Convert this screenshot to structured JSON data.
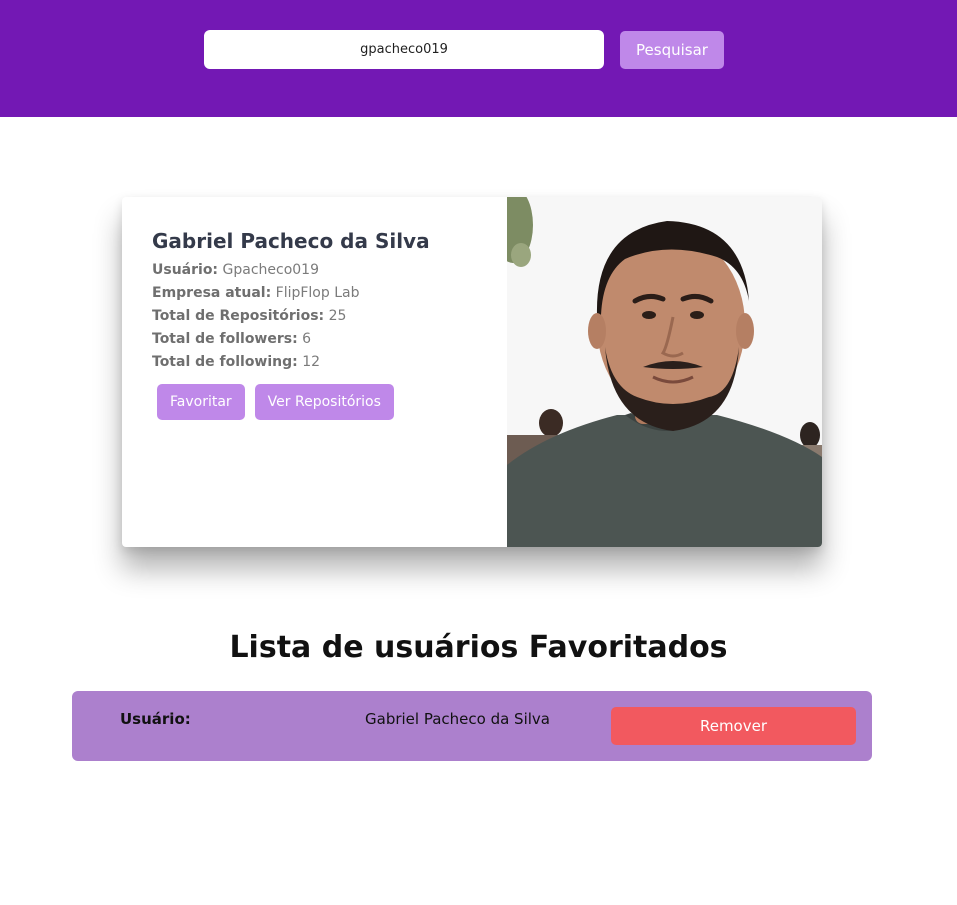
{
  "search": {
    "value": "gpacheco019",
    "button_label": "Pesquisar"
  },
  "profile": {
    "name": "Gabriel Pacheco da Silva",
    "fields": [
      {
        "label": "Usuário:",
        "value": "Gpacheco019"
      },
      {
        "label": "Empresa atual:",
        "value": "FlipFlop Lab"
      },
      {
        "label": "Total de Repositórios:",
        "value": "25"
      },
      {
        "label": "Total de followers:",
        "value": "6"
      },
      {
        "label": "Total de following:",
        "value": "12"
      }
    ],
    "favorite_button": "Favoritar",
    "repos_button": "Ver Repositórios"
  },
  "favorites": {
    "title": "Lista de usuários Favoritados",
    "items": [
      {
        "label": "Usuário:",
        "value": "Gabriel Pacheco da Silva",
        "remove_label": "Remover"
      }
    ]
  },
  "colors": {
    "header": "#7318b4",
    "button": "#bf88e9",
    "favorite_row": "#ac80cd",
    "remove": "#f2595f"
  }
}
